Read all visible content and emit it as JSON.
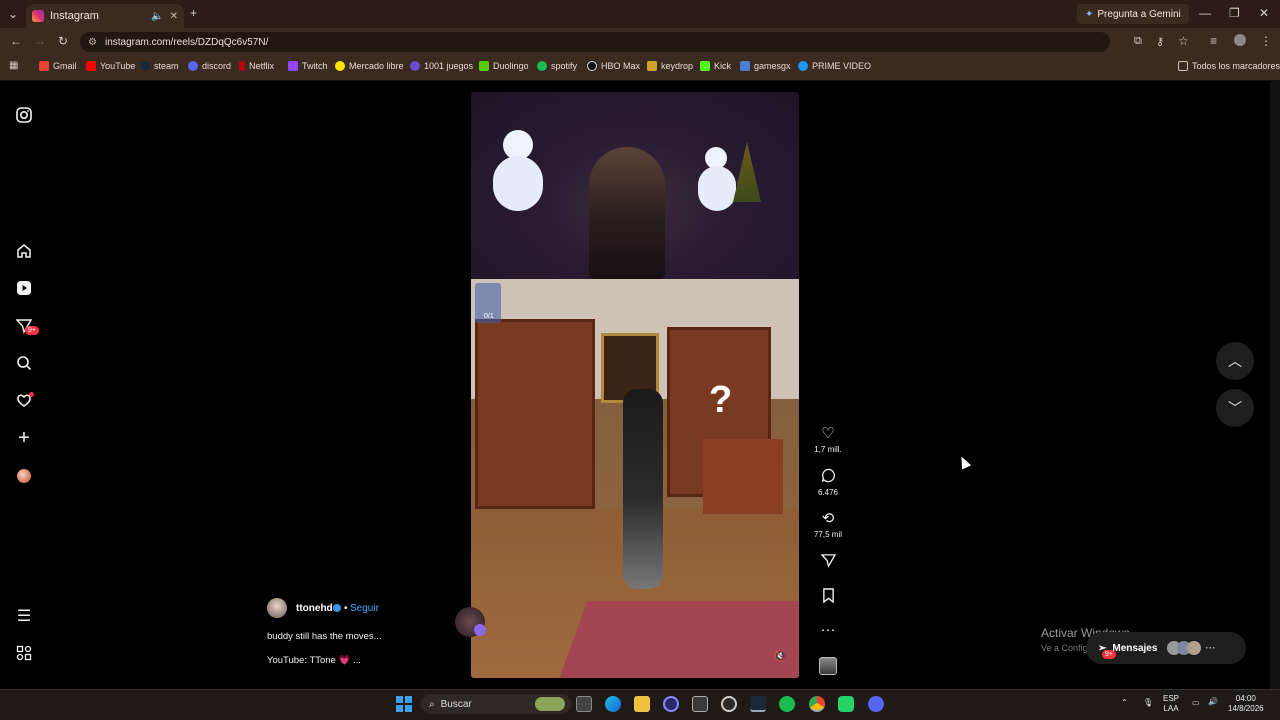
{
  "browser": {
    "tab_title": "Instagram",
    "gemini_label": "Pregunta a Gemini",
    "url": "instagram.com/reels/DZDqQc6v57N/",
    "bookmarks": [
      "Gmail",
      "YouTube",
      "steam",
      "discord",
      "Netflix",
      "Twitch",
      "Mercado libre",
      "1001 juegos",
      "Duolingo",
      "spotify",
      "HBO Max",
      "keydrop",
      "Kick",
      "gamesgx",
      "PRIME VIDEO"
    ],
    "all_bookmarks": "Todos los marcadores",
    "colors": {
      "tabstrip": "#2b1d16",
      "toolbar": "#3a2a20"
    }
  },
  "sidebar": {
    "notifications_badge": "9+",
    "icons": [
      "instagram-logo-icon",
      "home-icon",
      "reels-icon",
      "messages-icon",
      "search-icon",
      "heart-icon",
      "plus-icon",
      "profile-icon",
      "menu-icon",
      "more-icon"
    ]
  },
  "reel": {
    "counter": "0/1",
    "username": "ttonehd",
    "follow": "Seguir",
    "caption_line1": "buddy still has the moves...",
    "caption_line2": "YouTube: TTone 💗 ..."
  },
  "actions": {
    "likes": "1,7 mill.",
    "comments": "6.476",
    "reposts": "77,5 mil"
  },
  "messages": {
    "label": "Mensajes",
    "badge": "9+"
  },
  "windows_watermark": {
    "line1": "Activar Windows",
    "line2": "Ve a Configuración para activar Windows."
  },
  "taskbar": {
    "search": "Buscar",
    "lang1": "ESP",
    "lang2": "LAA",
    "time": "04:00",
    "date": "14/8/2026"
  }
}
